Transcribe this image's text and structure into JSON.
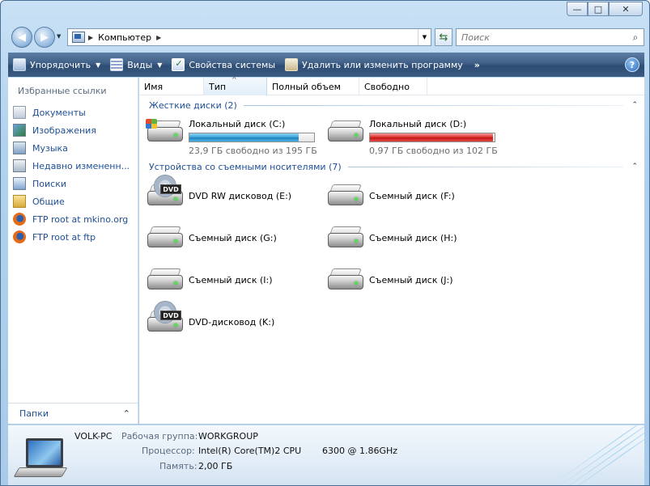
{
  "window": {
    "title": "Компьютер"
  },
  "caption": {
    "minimize": "—",
    "maximize": "□",
    "close": "✕"
  },
  "nav": {
    "back": "◀",
    "forward": "▶",
    "address_segment": "Компьютер",
    "search_placeholder": "Поиск"
  },
  "toolbar": {
    "organize": "Упорядочить",
    "views": "Виды",
    "system_properties": "Свойства системы",
    "uninstall": "Удалить или изменить программу",
    "more": "»",
    "help": "?"
  },
  "sidebar": {
    "title": "Избранные ссылки",
    "items": [
      {
        "label": "Документы",
        "icon": "documents-icon"
      },
      {
        "label": "Изображения",
        "icon": "pictures-icon"
      },
      {
        "label": "Музыка",
        "icon": "music-icon"
      },
      {
        "label": "Недавно измененн...",
        "icon": "recent-icon"
      },
      {
        "label": "Поиски",
        "icon": "searches-icon"
      },
      {
        "label": "Общие",
        "icon": "public-folder-icon"
      },
      {
        "label": "FTP root at mkino.org",
        "icon": "firefox-icon"
      },
      {
        "label": "FTP root at ftp",
        "icon": "firefox-icon"
      }
    ],
    "folders_label": "Папки"
  },
  "columns": [
    "Имя",
    "Тип",
    "Полный объем",
    "Свободно"
  ],
  "groups": {
    "hard_disks": "Жесткие диски (2)",
    "removable": "Устройства со съемными носителями (7)"
  },
  "hard_disks": [
    {
      "name": "Локальный диск (C:)",
      "free_text": "23,9 ГБ свободно из 195 ГБ",
      "used_fraction": 0.877,
      "bar_color": "#2b8fd0"
    },
    {
      "name": "Локальный диск (D:)",
      "free_text": "0,97 ГБ свободно из 102 ГБ",
      "used_fraction": 0.99,
      "bar_color": "#d41d1d"
    }
  ],
  "removable": [
    {
      "name": "DVD RW дисковод (E:)",
      "icon": "dvd-drive-icon"
    },
    {
      "name": "Съемный диск (F:)",
      "icon": "removable-disk-icon"
    },
    {
      "name": "Съемный диск (G:)",
      "icon": "removable-disk-icon"
    },
    {
      "name": "Съемный диск (H:)",
      "icon": "removable-disk-icon"
    },
    {
      "name": "Съемный диск (I:)",
      "icon": "removable-disk-icon"
    },
    {
      "name": "Съемный диск (J:)",
      "icon": "removable-disk-icon"
    },
    {
      "name": "DVD-дисковод (K:)",
      "icon": "dvd-drive-icon"
    }
  ],
  "dvd_label": "DVD",
  "details": {
    "computer_name": "VOLK-PC",
    "workgroup_label": "Рабочая группа:",
    "workgroup": "WORKGROUP",
    "cpu_label": "Процессор:",
    "cpu": "Intel(R) Core(TM)2 CPU",
    "cpu_model": "6300  @ 1.86GHz",
    "memory_label": "Память:",
    "memory": "2,00 ГБ"
  }
}
